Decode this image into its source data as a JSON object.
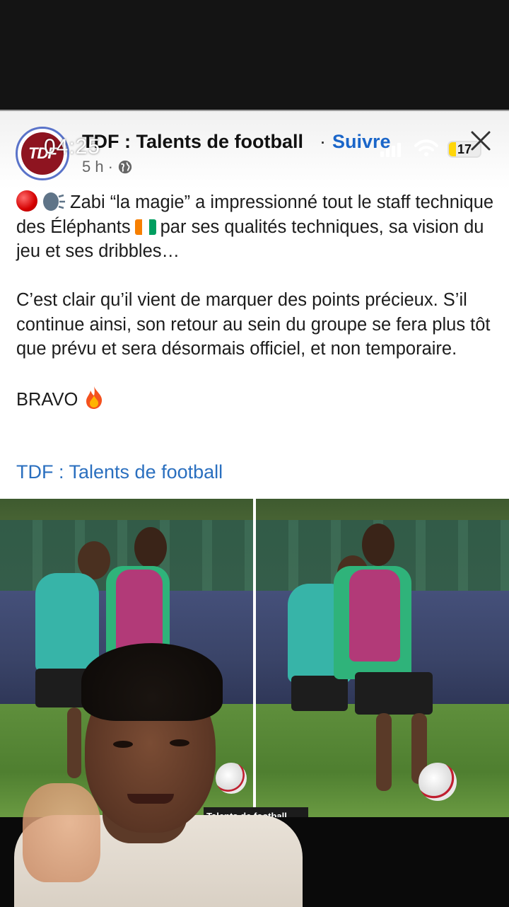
{
  "status_bar": {
    "time": "04:25",
    "battery": "17"
  },
  "post": {
    "page_name": "TDF : Talents de football",
    "separator": "·",
    "follow_label": "Suivre",
    "time_ago": "5 h",
    "meta_sep": "·",
    "avatar_text": "TDF",
    "paragraph1_a": "Zabi “la magie” a impressionné tout le staff technique des Éléphants",
    "paragraph1_b": "par ses qualités techniques, sa vision du jeu et ses dribbles…",
    "paragraph2": "C’est clair qu’il vient de marquer des points précieux. S’il continue ainsi, son retour au sein du groupe se fera plus tôt que prévu et sera désormais officiel, et non temporaire.",
    "paragraph3": "BRAVO",
    "link_text": "TDF : Talents de football",
    "photo_watermark": "Talents de football"
  },
  "icons": {
    "close": "close-icon",
    "globe": "globe-icon",
    "red_circle": "red-circle-emoji",
    "speaking_head": "speaking-head-emoji",
    "flag": "ivory-coast-flag-emoji",
    "fire": "fire-emoji"
  },
  "colors": {
    "link_blue": "#1b66c9",
    "flag_orange": "#f77f00",
    "flag_green": "#009e60"
  }
}
